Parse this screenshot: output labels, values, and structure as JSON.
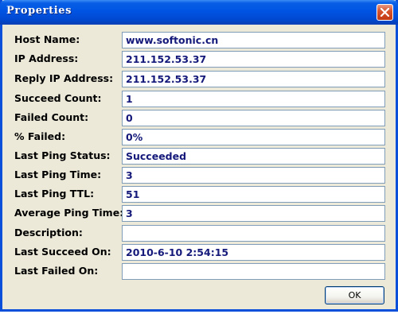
{
  "window": {
    "title": "Properties",
    "close_icon": "close-icon"
  },
  "fields": [
    {
      "label": "Host Name:",
      "value": "www.softonic.cn"
    },
    {
      "label": "IP Address:",
      "value": "211.152.53.37"
    },
    {
      "label": "Reply IP Address:",
      "value": "211.152.53.37"
    },
    {
      "label": "Succeed Count:",
      "value": "1"
    },
    {
      "label": "Failed Count:",
      "value": "0"
    },
    {
      "label": "% Failed:",
      "value": "0%"
    },
    {
      "label": "Last Ping Status:",
      "value": "Succeeded"
    },
    {
      "label": "Last Ping Time:",
      "value": "3"
    },
    {
      "label": "Last Ping TTL:",
      "value": "51"
    },
    {
      "label": "Average Ping Time:",
      "value": "3"
    },
    {
      "label": "Description:",
      "value": ""
    },
    {
      "label": "Last Succeed On:",
      "value": "2010-6-10 2:54:15"
    },
    {
      "label": "Last Failed On:",
      "value": ""
    }
  ],
  "buttons": {
    "ok_label": "OK"
  },
  "colors": {
    "titlebar": "#0054e3",
    "field_text": "#14197a",
    "dialog_bg": "#ece9d8"
  }
}
